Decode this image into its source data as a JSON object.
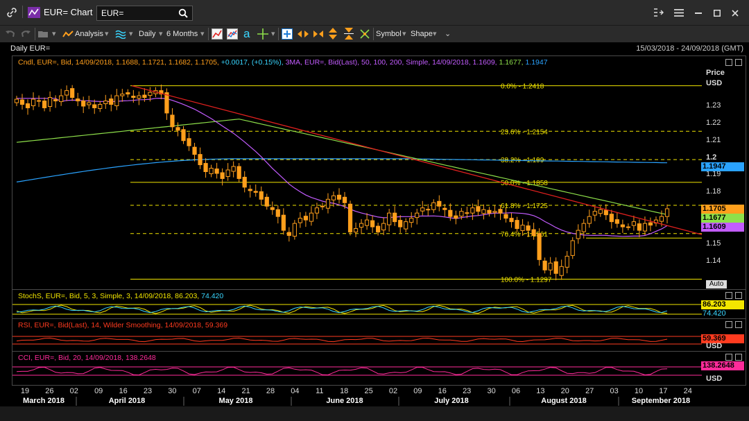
{
  "window": {
    "title": "EUR= Chart",
    "search_value": "EUR=",
    "menu_icons": [
      "link-icon",
      "chart-app-icon",
      "search-icon",
      "popout-icon",
      "menu-icon",
      "minimize-icon",
      "maximize-icon",
      "close-icon"
    ]
  },
  "toolbar": {
    "analysis": "Analysis",
    "interval": "Daily",
    "period": "6 Months",
    "symbol": "Symbol",
    "shape": "Shape"
  },
  "header": {
    "left": "Daily EUR=",
    "right": "15/03/2018 - 24/09/2018 (GMT)"
  },
  "legends": {
    "price": [
      {
        "text": "Cndl, EUR=, Bid, 14/09/2018, 1.1688, 1.1721, 1.1682, 1.1705, ",
        "color": "#ff9f1c"
      },
      {
        "text": "+0.0017, (+0.15%), ",
        "color": "#39d6ff"
      },
      {
        "text": "3MA, EUR=, Bid(Last), 50, 100, 200, Simple, 14/09/2018, 1.1609, ",
        "color": "#c35cff"
      },
      {
        "text": "1.1677, ",
        "color": "#8ee04a"
      },
      {
        "text": "1.1947",
        "color": "#2aa3ff"
      }
    ],
    "stoch": [
      {
        "text": "StochS, EUR=, Bid, 5, 3, Simple, 3, 14/09/2018, 86.203, ",
        "color": "#f2e600"
      },
      {
        "text": "74.420",
        "color": "#39d6ff"
      }
    ],
    "rsi": [
      {
        "text": "RSI, EUR=, Bid(Last), 14, Wilder Smoothing, 14/09/2018, 59.369",
        "color": "#ff3b1f"
      }
    ],
    "cci": [
      {
        "text": "CCI, EUR=, Bid, 20, 14/09/2018, 138.2648",
        "color": "#ff2b9a"
      }
    ]
  },
  "axis": {
    "price_title": "Price",
    "price_unit": "USD",
    "price_ticks": [
      "1.23",
      "1.22",
      "1.21",
      "1.2",
      "1.19",
      "1.18",
      "1.17",
      "1.16",
      "1.15",
      "1.14"
    ],
    "auto_label": "Auto",
    "usd": "USD",
    "value_labels": {
      "close": "1.1705",
      "ma100": "1.1677",
      "ma200": "1.1947",
      "ma50": "1.1609",
      "stoch_k": "86.203",
      "stoch_d": "74.420",
      "rsi": "59.369",
      "cci": "138.2648"
    },
    "x_day_labels": [
      "19",
      "26",
      "02",
      "09",
      "16",
      "23",
      "30",
      "07",
      "14",
      "21",
      "28",
      "04",
      "11",
      "18",
      "25",
      "02",
      "09",
      "16",
      "23",
      "30",
      "06",
      "13",
      "20",
      "27",
      "03",
      "10",
      "17",
      "24"
    ],
    "x_month_labels": [
      "March 2018",
      "April 2018",
      "May 2018",
      "June 2018",
      "July 2018",
      "August 2018",
      "September 2018"
    ]
  },
  "colors": {
    "candle": "#ff9f1c",
    "ma50": "#c35cff",
    "ma100": "#8ee04a",
    "ma200": "#2aa3ff",
    "trend": "#e0201e",
    "fib": "#f2e600",
    "stoch_k": "#f2e600",
    "stoch_d": "#39d6ff",
    "rsi": "#ff3b1f",
    "cci": "#ff2b9a"
  },
  "chart_data": {
    "type": "candlestick",
    "title": "Daily EUR=",
    "ylim": [
      1.125,
      1.245
    ],
    "fibonacci": [
      {
        "label": "0.0%",
        "value": 1.2418
      },
      {
        "label": "23.6%",
        "value": 1.2154
      },
      {
        "label": "38.2%",
        "value": 1.199
      },
      {
        "label": "50.0%",
        "value": 1.1858
      },
      {
        "label": "61.8%",
        "value": 1.1725
      },
      {
        "label": "76.4%",
        "value": 1.1561
      },
      {
        "label": "100.0%",
        "value": 1.1297
      }
    ],
    "closes": [
      1.234,
      1.231,
      1.229,
      1.234,
      1.233,
      1.229,
      1.235,
      1.233,
      1.236,
      1.239,
      1.235,
      1.233,
      1.23,
      1.232,
      1.229,
      1.231,
      1.233,
      1.231,
      1.236,
      1.237,
      1.237,
      1.235,
      1.236,
      1.235,
      1.238,
      1.239,
      1.237,
      1.226,
      1.218,
      1.216,
      1.21,
      1.207,
      1.202,
      1.196,
      1.192,
      1.194,
      1.191,
      1.188,
      1.193,
      1.195,
      1.188,
      1.183,
      1.181,
      1.18,
      1.176,
      1.172,
      1.17,
      1.166,
      1.158,
      1.155,
      1.162,
      1.165,
      1.164,
      1.168,
      1.171,
      1.172,
      1.176,
      1.178,
      1.176,
      1.174,
      1.157,
      1.159,
      1.162,
      1.164,
      1.16,
      1.157,
      1.162,
      1.168,
      1.163,
      1.16,
      1.163,
      1.165,
      1.168,
      1.171,
      1.17,
      1.174,
      1.172,
      1.17,
      1.166,
      1.165,
      1.169,
      1.168,
      1.171,
      1.169,
      1.17,
      1.168,
      1.169,
      1.168,
      1.165,
      1.163,
      1.159,
      1.161,
      1.158,
      1.155,
      1.141,
      1.135,
      1.139,
      1.133,
      1.137,
      1.143,
      1.152,
      1.158,
      1.162,
      1.166,
      1.169,
      1.17,
      1.167,
      1.163,
      1.162,
      1.16,
      1.16,
      1.163,
      1.158,
      1.162,
      1.161,
      1.164,
      1.166,
      1.1705
    ]
  }
}
